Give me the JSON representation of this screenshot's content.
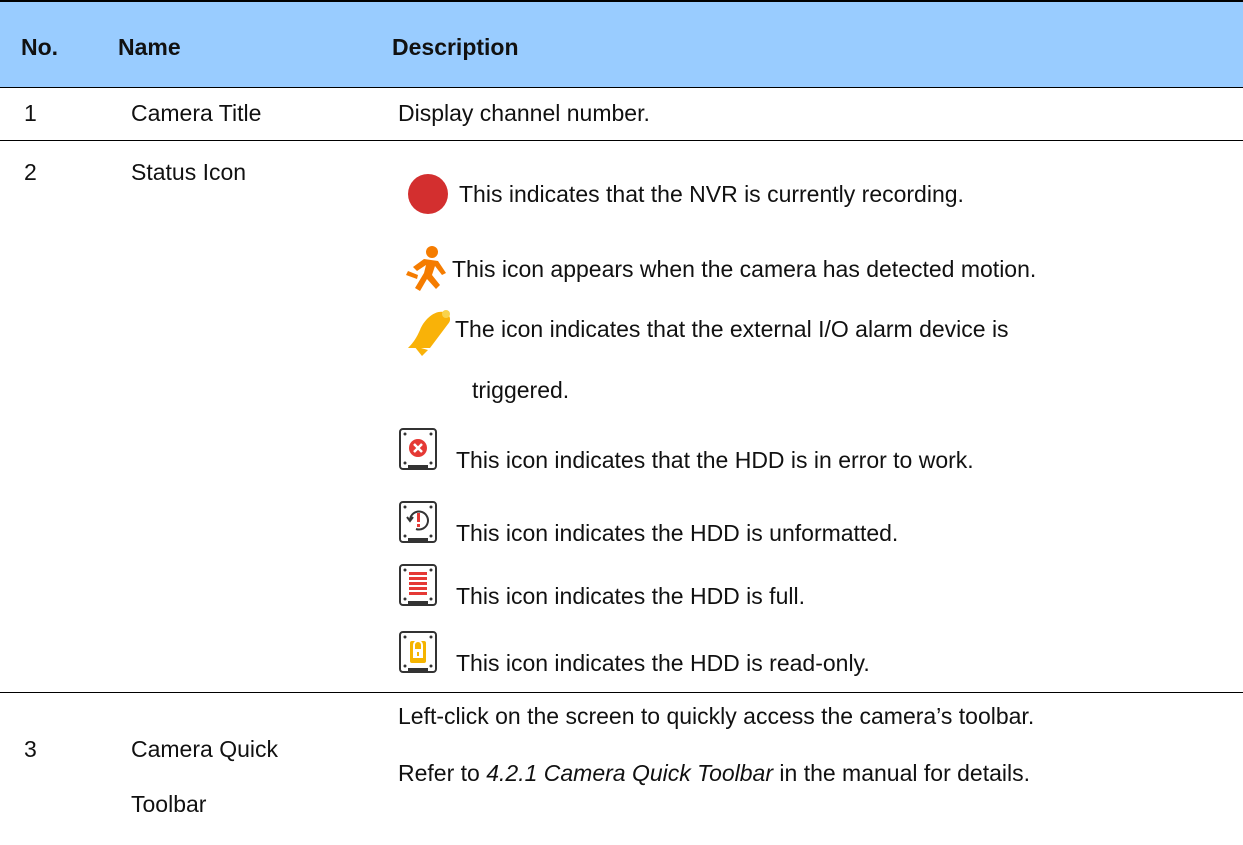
{
  "headers": {
    "no": "No.",
    "name": "Name",
    "description": "Description"
  },
  "rows": [
    {
      "no": "1",
      "name": "Camera Title",
      "description": "Display channel number."
    },
    {
      "no": "2",
      "name": "Status Icon",
      "items": [
        {
          "icon": "record-icon",
          "text": "This indicates that the NVR is currently recording."
        },
        {
          "icon": "motion-icon",
          "text": "This icon appears when the camera has detected motion."
        },
        {
          "icon": "alarm-bell-icon",
          "text": "The icon indicates that the external I/O alarm device is",
          "text_cont": "triggered."
        },
        {
          "icon": "hdd-error-icon",
          "text": "This icon indicates that the HDD is in error to work."
        },
        {
          "icon": "hdd-unformatted-icon",
          "text": "This icon indicates the HDD is unformatted."
        },
        {
          "icon": "hdd-full-icon",
          "text": "This icon indicates the HDD is full."
        },
        {
          "icon": "hdd-readonly-icon",
          "text": "This icon indicates the HDD is read-only."
        }
      ]
    },
    {
      "no": "3",
      "name_line1": "Camera Quick",
      "name_line2": "Toolbar",
      "desc_line1": "Left-click on the screen to quickly access the camera’s toolbar.",
      "desc_line2_pre": "Refer to ",
      "desc_line2_em": "4.2.1 Camera Quick Toolbar",
      "desc_line2_post": " in the manual for details."
    }
  ],
  "colors": {
    "header_bg": "#99ccff",
    "record": "#d32f2f",
    "motion": "#f57c00",
    "bell": "#f9b208",
    "hdd_error": "#e53935",
    "hdd_full": "#e53935",
    "hdd_lock": "#f5b400"
  }
}
